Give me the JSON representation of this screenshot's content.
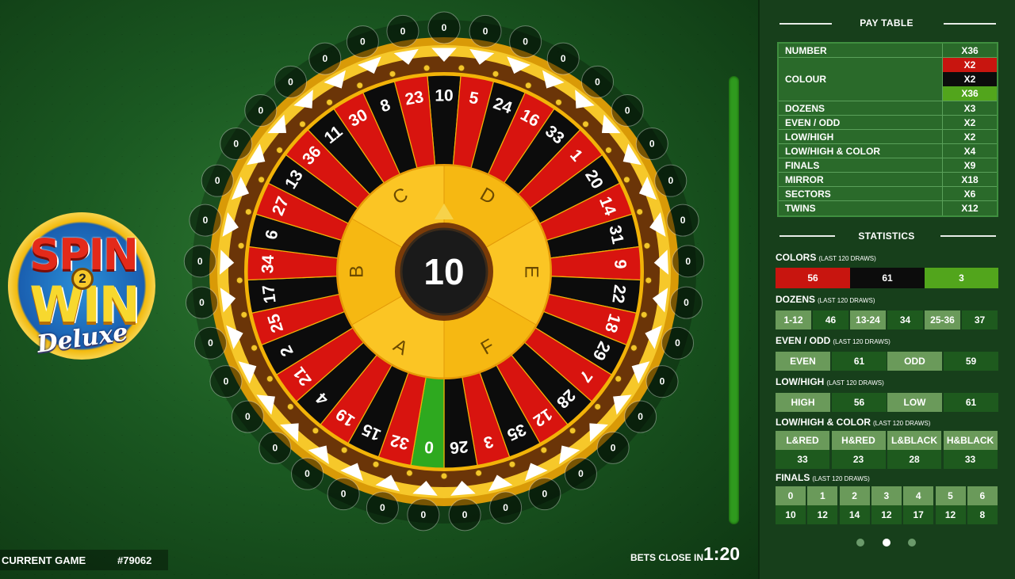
{
  "wheel": {
    "numbers": [
      {
        "n": "10",
        "c": "black"
      },
      {
        "n": "5",
        "c": "red"
      },
      {
        "n": "24",
        "c": "black"
      },
      {
        "n": "16",
        "c": "red"
      },
      {
        "n": "33",
        "c": "black"
      },
      {
        "n": "1",
        "c": "red"
      },
      {
        "n": "20",
        "c": "black"
      },
      {
        "n": "14",
        "c": "red"
      },
      {
        "n": "31",
        "c": "black"
      },
      {
        "n": "9",
        "c": "red"
      },
      {
        "n": "22",
        "c": "black"
      },
      {
        "n": "18",
        "c": "red"
      },
      {
        "n": "29",
        "c": "black"
      },
      {
        "n": "7",
        "c": "red"
      },
      {
        "n": "28",
        "c": "black"
      },
      {
        "n": "12",
        "c": "red"
      },
      {
        "n": "35",
        "c": "black"
      },
      {
        "n": "3",
        "c": "red"
      },
      {
        "n": "26",
        "c": "black"
      },
      {
        "n": "0",
        "c": "green"
      },
      {
        "n": "32",
        "c": "red"
      },
      {
        "n": "15",
        "c": "black"
      },
      {
        "n": "19",
        "c": "red"
      },
      {
        "n": "4",
        "c": "black"
      },
      {
        "n": "21",
        "c": "red"
      },
      {
        "n": "2",
        "c": "black"
      },
      {
        "n": "25",
        "c": "red"
      },
      {
        "n": "17",
        "c": "black"
      },
      {
        "n": "34",
        "c": "red"
      },
      {
        "n": "6",
        "c": "black"
      },
      {
        "n": "27",
        "c": "red"
      },
      {
        "n": "13",
        "c": "black"
      },
      {
        "n": "36",
        "c": "red"
      },
      {
        "n": "11",
        "c": "black"
      },
      {
        "n": "30",
        "c": "red"
      },
      {
        "n": "8",
        "c": "black"
      },
      {
        "n": "23",
        "c": "red"
      }
    ],
    "outer_counters": [
      "0",
      "0",
      "0",
      "0",
      "0",
      "0",
      "0",
      "0",
      "0",
      "0",
      "0",
      "0",
      "0",
      "0",
      "0",
      "0",
      "0",
      "0",
      "0",
      "0",
      "0",
      "0",
      "0",
      "0",
      "0",
      "0",
      "0",
      "0",
      "0",
      "0",
      "0",
      "0",
      "0",
      "0",
      "0",
      "0",
      "0"
    ],
    "sectors": [
      "A",
      "B",
      "C",
      "D",
      "E",
      "F"
    ],
    "center_number": "10"
  },
  "colors": {
    "red": "#d8140f",
    "black": "#0c0c0c",
    "green": "#2ea91f",
    "gold": "#f2b308"
  },
  "logo": {
    "spin": "SPIN",
    "win": "WIN",
    "two": "2",
    "deluxe": "Deluxe"
  },
  "current_game": {
    "label": "CURRENT GAME",
    "number": "#79062"
  },
  "bets_close": {
    "label": "BETS CLOSE IN",
    "time": "1:20"
  },
  "paytable": {
    "title": "PAY TABLE",
    "rows_top": [
      {
        "name": "NUMBER",
        "val": "X36"
      }
    ],
    "colour": {
      "name": "COLOUR",
      "vals": [
        {
          "v": "X2",
          "bg": "#c8150f"
        },
        {
          "v": "X2",
          "bg": "#0c0c0c"
        },
        {
          "v": "X36",
          "bg": "#52a51c"
        }
      ]
    },
    "rows": [
      {
        "name": "DOZENS",
        "val": "X3"
      },
      {
        "name": "EVEN / ODD",
        "val": "X2"
      },
      {
        "name": "LOW/HIGH",
        "val": "X2"
      },
      {
        "name": "LOW/HIGH & COLOR",
        "val": "X4"
      },
      {
        "name": "FINALS",
        "val": "X9"
      },
      {
        "name": "MIRROR",
        "val": "X18"
      },
      {
        "name": "SECTORS",
        "val": "X6"
      },
      {
        "name": "TWINS",
        "val": "X12"
      }
    ]
  },
  "statistics": {
    "title": "STATISTICS",
    "last": "(LAST 120 DRAWS)",
    "colors": {
      "label": "COLORS",
      "values": [
        "56",
        "61",
        "3"
      ]
    },
    "dozens": {
      "label": "DOZENS",
      "items": [
        {
          "k": "1-12",
          "v": "46"
        },
        {
          "k": "13-24",
          "v": "34"
        },
        {
          "k": "25-36",
          "v": "37"
        }
      ]
    },
    "even_odd": {
      "label": "EVEN / ODD",
      "items": [
        {
          "k": "EVEN",
          "v": "61"
        },
        {
          "k": "ODD",
          "v": "59"
        }
      ]
    },
    "low_high": {
      "label": "LOW/HIGH",
      "items": [
        {
          "k": "HIGH",
          "v": "56"
        },
        {
          "k": "LOW",
          "v": "61"
        }
      ]
    },
    "low_high_color": {
      "label": "LOW/HIGH & COLOR",
      "items": [
        {
          "k": "L&RED",
          "v": "33"
        },
        {
          "k": "H&RED",
          "v": "23"
        },
        {
          "k": "L&BLACK",
          "v": "28"
        },
        {
          "k": "H&BLACK",
          "v": "33"
        }
      ]
    },
    "finals": {
      "label": "FINALS",
      "keys": [
        "0",
        "1",
        "2",
        "3",
        "4",
        "5",
        "6"
      ],
      "vals": [
        "10",
        "12",
        "14",
        "12",
        "17",
        "12",
        "8"
      ]
    }
  }
}
